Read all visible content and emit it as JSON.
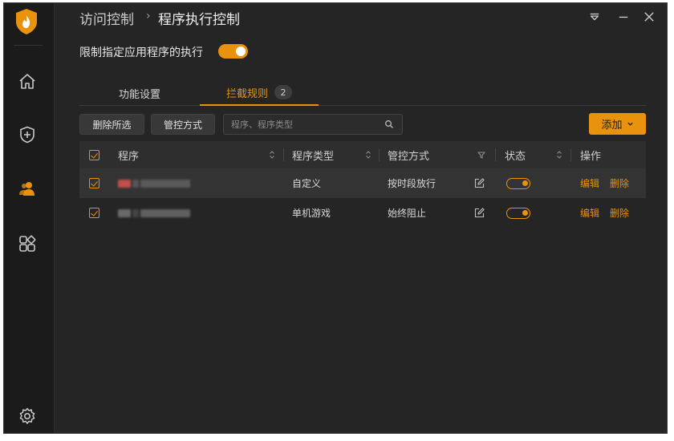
{
  "breadcrumb": {
    "root": "访问控制",
    "separator": "›",
    "current": "程序执行控制"
  },
  "restrict": {
    "label": "限制指定应用程序的执行",
    "enabled": true
  },
  "tabs": [
    {
      "label": "功能设置",
      "active": false
    },
    {
      "label": "拦截规则",
      "active": true,
      "badge": "2"
    }
  ],
  "toolbar": {
    "delete_label": "删除所选",
    "mode_label": "管控方式",
    "search_placeholder": "程序、程序类型",
    "add_label": "添加"
  },
  "table": {
    "headers": {
      "program": "程序",
      "type": "程序类型",
      "mode": "管控方式",
      "status": "状态",
      "actions": "操作"
    },
    "rows": [
      {
        "program": "",
        "type": "自定义",
        "mode": "按时段放行",
        "enabled": true,
        "edit": "编辑",
        "delete": "删除"
      },
      {
        "program": "",
        "type": "单机游戏",
        "mode": "始终阻止",
        "enabled": true,
        "edit": "编辑",
        "delete": "删除"
      }
    ]
  },
  "colors": {
    "accent": "#e8920d",
    "background": "#252525",
    "sidebar": "#1b1b1b"
  }
}
